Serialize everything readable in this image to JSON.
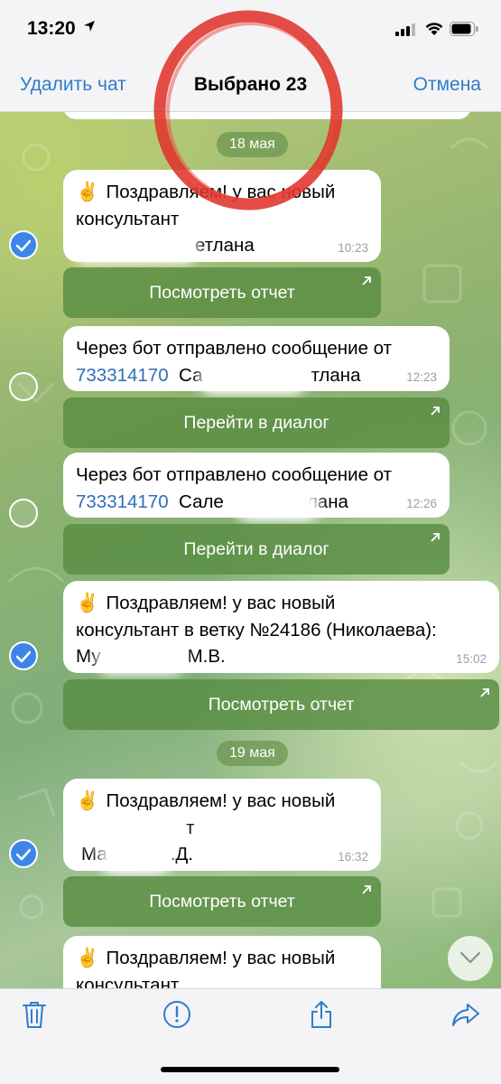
{
  "status_bar": {
    "time": "13:20"
  },
  "nav": {
    "left": "Удалить чат",
    "title": "Выбрано 23",
    "right": "Отмена"
  },
  "dates": [
    "18 мая",
    "19 мая"
  ],
  "messages": [
    {
      "lines": [
        "Поздравляем! у вас новый",
        "консультант",
        "етлана"
      ],
      "emoji": "✌️",
      "time": "10:23",
      "button": "Посмотреть отчет",
      "selected": true
    },
    {
      "line1": "Через бот отправлено сообщение от",
      "id": "733314170",
      "name_start": "Са",
      "name_end": "тлана",
      "time": "12:23",
      "button": "Перейти в диалог",
      "selected": false
    },
    {
      "line1": "Через бот отправлено сообщение от",
      "id": "733314170",
      "name_start": "Сале",
      "name_end": "лана",
      "time": "12:26",
      "button": "Перейти в диалог",
      "selected": false
    },
    {
      "lines": [
        "Поздравляем! у вас новый",
        "консультант в ветку №24186 (Николаева):",
        "М.В."
      ],
      "line3_start": "Му",
      "emoji": "✌️",
      "time": "15:02",
      "button": "Посмотреть отчет",
      "selected": true
    },
    {
      "lines": [
        "Поздравляем! у вас новый",
        "т",
        "Ма",
        ".Д."
      ],
      "emoji": "✌️",
      "time": "16:32",
      "button": "Посмотреть отчет",
      "selected": true
    },
    {
      "lines": [
        "Поздравляем! у вас новый",
        "консультант"
      ],
      "emoji": "✌️"
    }
  ],
  "toolbar": {
    "icons": [
      "trash-icon",
      "report-icon",
      "share-icon",
      "forward-icon"
    ]
  },
  "colors": {
    "accent": "#2f7ccb",
    "check": "#3d86e8",
    "button": "#588c42"
  }
}
